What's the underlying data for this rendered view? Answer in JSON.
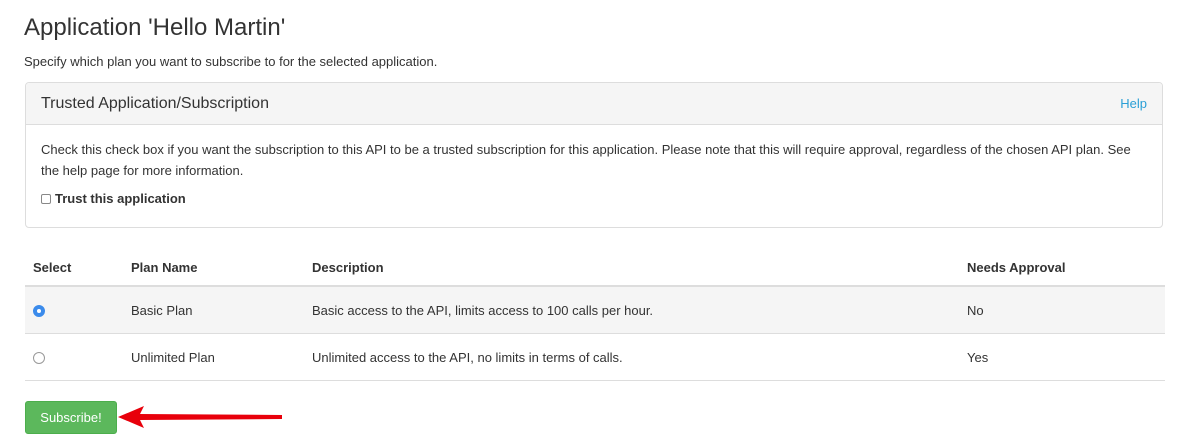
{
  "header": {
    "title": "Application 'Hello Martin'",
    "subtitle": "Specify which plan you want to subscribe to for the selected application."
  },
  "trusted_panel": {
    "title": "Trusted Application/Subscription",
    "help_label": "Help",
    "description": "Check this check box if you want the subscription to this API to be a trusted subscription for this application. Please note that this will require approval, regardless of the chosen API plan. See the help page for more information.",
    "checkbox_label": "Trust this application",
    "checkbox_checked": false
  },
  "plans_table": {
    "headers": [
      "Select",
      "Plan Name",
      "Description",
      "Needs Approval"
    ],
    "rows": [
      {
        "selected": true,
        "name": "Basic Plan",
        "description": "Basic access to the API, limits access to 100 calls per hour.",
        "needs_approval": "No"
      },
      {
        "selected": false,
        "name": "Unlimited Plan",
        "description": "Unlimited access to the API, no limits in terms of calls.",
        "needs_approval": "Yes"
      }
    ]
  },
  "actions": {
    "subscribe_label": "Subscribe!"
  },
  "colors": {
    "accent_green": "#5cb85c",
    "link_blue": "#2a9fd6",
    "annotation_arrow": "#e8000b",
    "radio_selected": "#3b8beb"
  }
}
